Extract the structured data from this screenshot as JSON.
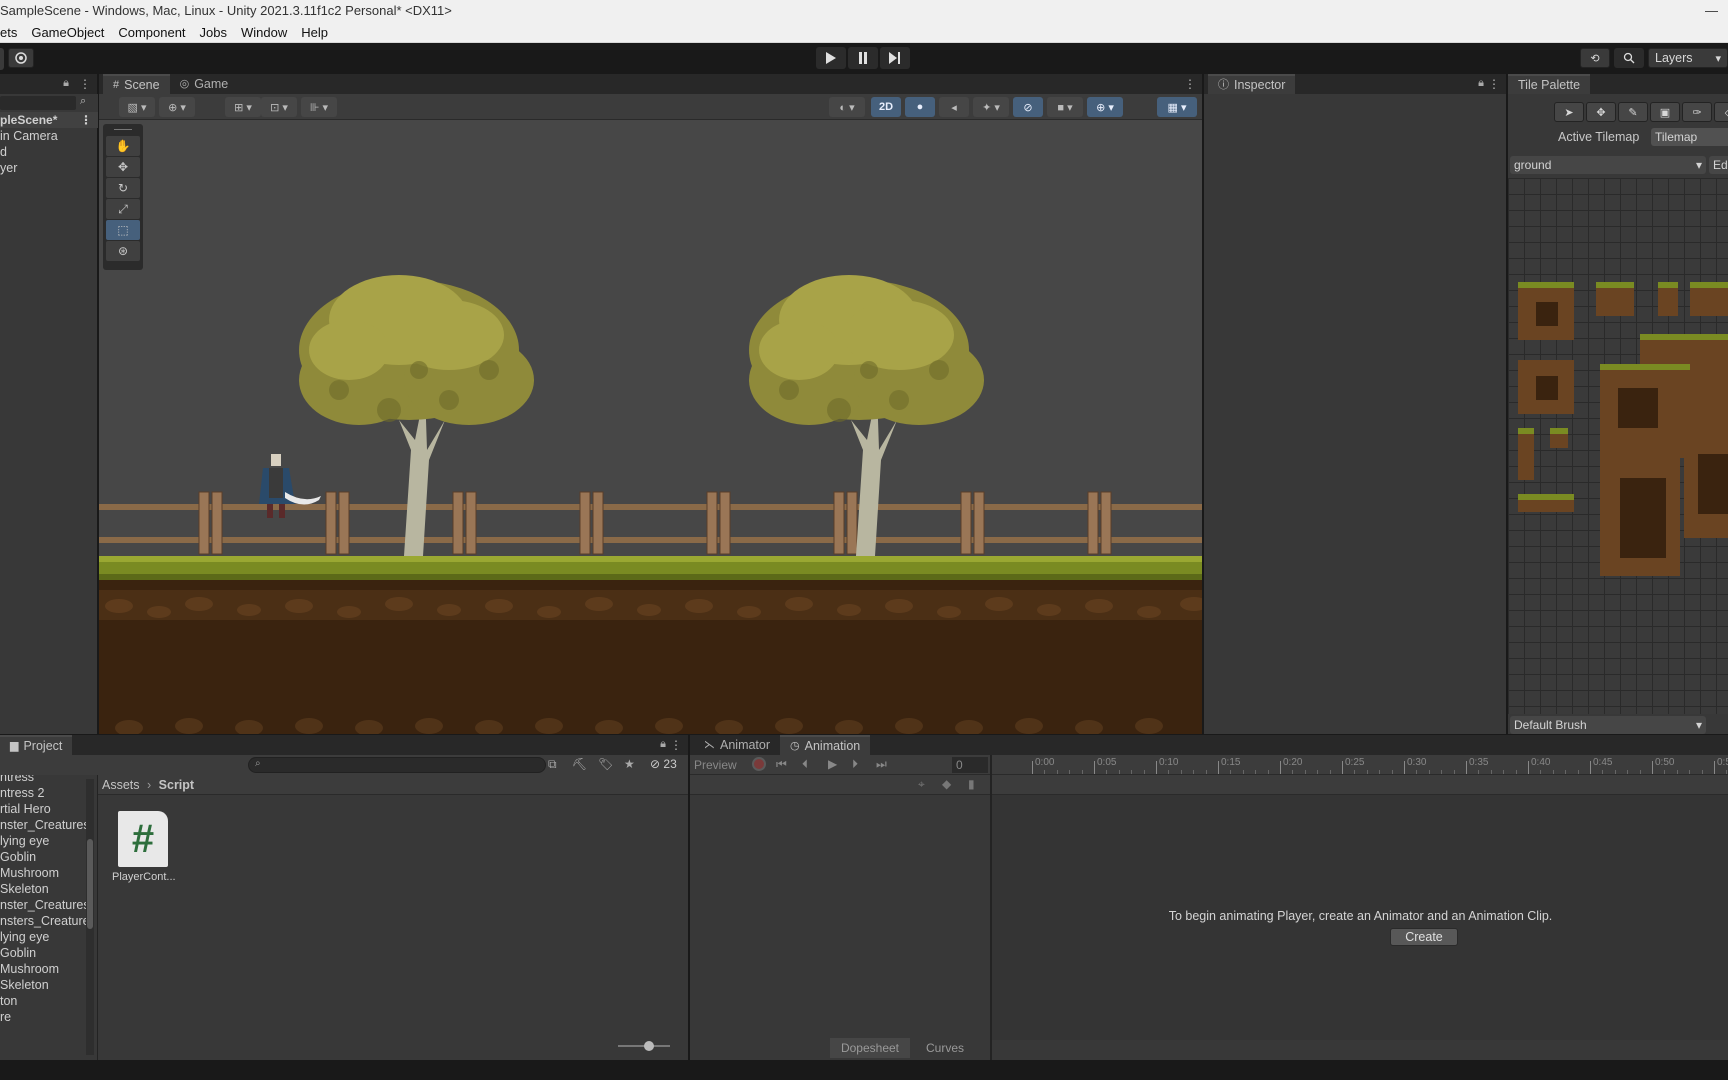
{
  "window": {
    "title": "SampleScene - Windows, Mac, Linux - Unity 2021.3.11f1c2 Personal* <DX11>"
  },
  "menu": {
    "items": [
      "ets",
      "GameObject",
      "Component",
      "Jobs",
      "Window",
      "Help"
    ]
  },
  "toolbar": {
    "layers_label": "Layers"
  },
  "hierarchy": {
    "scene_label": "pleScene*",
    "items": [
      "in Camera",
      "d",
      "yer"
    ]
  },
  "scene": {
    "tabs": [
      {
        "label": "Scene",
        "icon": "hash-icon"
      },
      {
        "label": "Game",
        "icon": "gamepad-icon"
      }
    ],
    "mode_2d_label": "2D"
  },
  "inspector": {
    "tab_label": "Inspector"
  },
  "tile_palette": {
    "tab_label": "Tile Palette",
    "active_tilemap_label": "Active Tilemap",
    "active_tilemap_value": "Tilemap",
    "palette_value": "ground",
    "edit_label": "Edi",
    "brush_value": "Default Brush"
  },
  "project": {
    "tab_label": "Project",
    "search_placeholder": "",
    "hidden_count": "23",
    "breadcrumb": [
      "Assets",
      "Script"
    ],
    "tree_items": [
      "ntress",
      "ntress 2",
      "rtial Hero",
      "nster_Creatures",
      "lying eye",
      "Goblin",
      "Mushroom",
      "Skeleton",
      "nster_Creatures",
      "nsters_Creature",
      "lying eye",
      "Goblin",
      "Mushroom",
      "Skeleton",
      "ton",
      "re"
    ],
    "assets": [
      {
        "name": "PlayerCont...",
        "icon": "csharp-script-icon",
        "glyph": "#"
      }
    ]
  },
  "animation": {
    "tabs": [
      {
        "label": "Animator",
        "icon": "animator-icon"
      },
      {
        "label": "Animation",
        "icon": "clock-icon"
      }
    ],
    "preview_label": "Preview",
    "frame_value": "0",
    "timeline_ticks": [
      "0:00",
      "0:05",
      "0:10",
      "0:15",
      "0:20",
      "0:25",
      "0:30",
      "0:35",
      "0:40",
      "0:45",
      "0:50",
      "0:5"
    ],
    "message": "To begin animating Player, create an Animator and an Animation Clip.",
    "create_label": "Create",
    "dopesheet_label": "Dopesheet",
    "curves_label": "Curves"
  },
  "colors": {
    "sky": "#474747",
    "grass": "#7a8b22",
    "dirt": "#3a230f",
    "accent": "#46607c"
  }
}
